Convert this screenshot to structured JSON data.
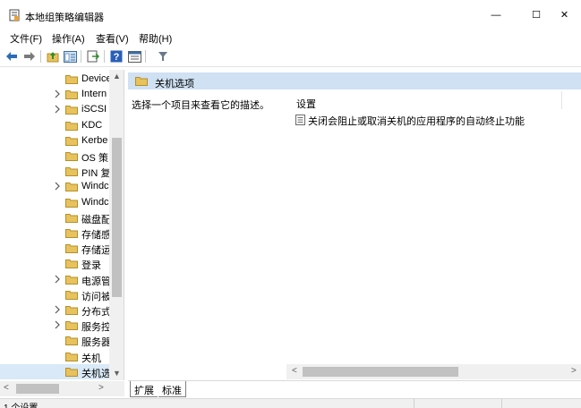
{
  "window": {
    "title": "本地组策略编辑器",
    "min_glyph": "—",
    "max_glyph": "☐",
    "close_glyph": "✕"
  },
  "menu": {
    "items": [
      "文件(F)",
      "操作(A)",
      "查看(V)",
      "帮助(H)"
    ]
  },
  "toolbar": {
    "icons": [
      "back-arrow-icon",
      "forward-arrow-icon",
      "up-folder-icon",
      "show-hide-tree-icon",
      "export-list-icon",
      "help-icon",
      "properties-icon",
      "filter-icon"
    ]
  },
  "tree": {
    "items": [
      {
        "label": "Device",
        "expandable": false
      },
      {
        "label": "Intern",
        "expandable": true
      },
      {
        "label": "iSCSI",
        "expandable": true
      },
      {
        "label": "KDC",
        "expandable": false
      },
      {
        "label": "Kerbe",
        "expandable": false
      },
      {
        "label": "OS 策",
        "expandable": false
      },
      {
        "label": "PIN 复",
        "expandable": false
      },
      {
        "label": "Windc",
        "expandable": true
      },
      {
        "label": "Windc",
        "expandable": false
      },
      {
        "label": "磁盘配",
        "expandable": false
      },
      {
        "label": "存储感",
        "expandable": false
      },
      {
        "label": "存储运",
        "expandable": false
      },
      {
        "label": "登录",
        "expandable": false
      },
      {
        "label": "电源管",
        "expandable": true
      },
      {
        "label": "访问被",
        "expandable": false
      },
      {
        "label": "分布式",
        "expandable": true
      },
      {
        "label": "服务控",
        "expandable": true
      },
      {
        "label": "服务器",
        "expandable": false
      },
      {
        "label": "关机",
        "expandable": false
      },
      {
        "label": "关机选",
        "expandable": false,
        "selected": true
      }
    ]
  },
  "header": {
    "title": "关机选项"
  },
  "description": {
    "text": "选择一个项目来查看它的描述。"
  },
  "list": {
    "column_header": "设置",
    "rows": [
      {
        "label": "关闭会阻止或取消关机的应用程序的自动终止功能"
      }
    ]
  },
  "tabs": {
    "items": [
      "扩展",
      "标准"
    ]
  },
  "status": {
    "text": "1 个设置"
  },
  "colors": {
    "folder": "#e8c25d",
    "selection": "#d9e9f7",
    "header_strip": "#cfe1f3",
    "nav_arrow": "#2a6cb8"
  }
}
